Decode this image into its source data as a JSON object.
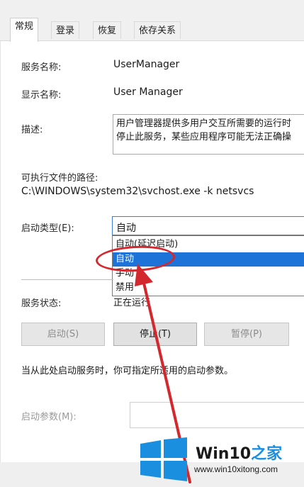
{
  "tabs": [
    {
      "label": "常规",
      "active": true
    },
    {
      "label": "登录",
      "active": false
    },
    {
      "label": "恢复",
      "active": false
    },
    {
      "label": "依存关系",
      "active": false
    }
  ],
  "service_name": {
    "label": "服务名称:",
    "value": "UserManager"
  },
  "display_name": {
    "label": "显示名称:",
    "value": "User Manager"
  },
  "description": {
    "label": "描述:",
    "line1": "用户管理器提供多用户交互所需要的运行时",
    "line2": "停止此服务，某些应用程序可能无法正确操"
  },
  "exe_path": {
    "label": "可执行文件的路径:",
    "value": "C:\\WINDOWS\\system32\\svchost.exe -k netsvcs"
  },
  "startup_type": {
    "label": "启动类型(E):",
    "selected": "自动",
    "options": [
      "自动(延迟启动)",
      "自动",
      "手动",
      "禁用"
    ],
    "highlighted_option": "自动"
  },
  "service_status": {
    "label": "服务状态:",
    "value": "正在运行"
  },
  "buttons": {
    "start": "启动(S)",
    "stop": "停止(T)",
    "pause": "暂停(P)"
  },
  "hint": "当从此处启动服务时，你可指定所适用的启动参数。",
  "start_params": {
    "label": "启动参数(M):",
    "value": ""
  },
  "watermark": {
    "title_main": "Win10",
    "title_accent": "之家",
    "url": "www.win10xitong.com"
  },
  "colors": {
    "selection": "#1e73d8",
    "annotation": "#d2282e",
    "brand_blue": "#1a8fe0"
  }
}
